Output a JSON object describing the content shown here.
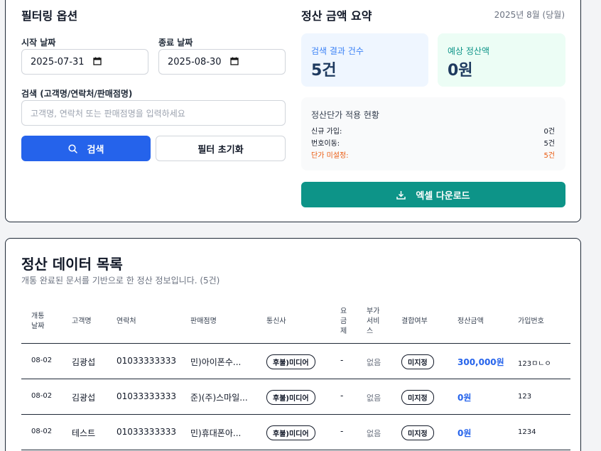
{
  "filter": {
    "title": "필터링 옵션",
    "start_label": "시작 날짜",
    "start_value": "2025-07-31",
    "end_label": "종료 날짜",
    "end_value": "2025-08-30",
    "search_label": "검색 (고객명/연락처/판매점명)",
    "search_placeholder": "고객명, 연락처 또는 판매점명을 입력하세요",
    "search_button": "검색",
    "reset_button": "필터 초기화"
  },
  "summary": {
    "title": "정산 금액 요약",
    "period": "2025년 8월 (당월)",
    "count_label": "검색 결과 건수",
    "count_value": "5건",
    "amount_label": "예상 정산액",
    "amount_value": "0원",
    "rate_title": "정산단가 적용 현황",
    "rates": [
      {
        "label": "신규 가입:",
        "value": "0건"
      },
      {
        "label": "번호이동:",
        "value": "5건"
      },
      {
        "label": "단가 미설정:",
        "value": "5건"
      }
    ],
    "excel_button": "엑셀 다운로드"
  },
  "list": {
    "title": "정산 데이터 목록",
    "subtitle": "개통 완료된 문서를 기반으로 한 정산 정보입니다. (5건)",
    "headers": {
      "date": "개통\n날짜",
      "customer": "고객명",
      "phone": "연락처",
      "store": "판매점명",
      "carrier": "통신사",
      "plan": "요\n금\n제",
      "extra": "부가\n서비\n스",
      "bundle": "결합여부",
      "amount": "정산금액",
      "join_no": "가입번호"
    },
    "rows": [
      {
        "date": "08-02",
        "customer": "김광섭",
        "phone": "01033333333",
        "store": "민)아이폰수...",
        "carrier": "후불)미디어",
        "plan": "-",
        "extra": "없음",
        "bundle": "미지정",
        "amount": "300,000원",
        "join_no": "123ㅁㄴㅇ"
      },
      {
        "date": "08-02",
        "customer": "김광섭",
        "phone": "01033333333",
        "store": "준)(주)스마일...",
        "carrier": "후불)미디어",
        "plan": "-",
        "extra": "없음",
        "bundle": "미지정",
        "amount": "0원",
        "join_no": "123"
      },
      {
        "date": "08-02",
        "customer": "테스트",
        "phone": "01033333333",
        "store": "민)휴대폰아...",
        "carrier": "후불)미디어",
        "plan": "-",
        "extra": "없음",
        "bundle": "미지정",
        "amount": "0원",
        "join_no": "1234"
      }
    ]
  },
  "colors": {
    "primary": "#2563eb",
    "teal": "#0d9488",
    "warn": "#ea580c"
  }
}
